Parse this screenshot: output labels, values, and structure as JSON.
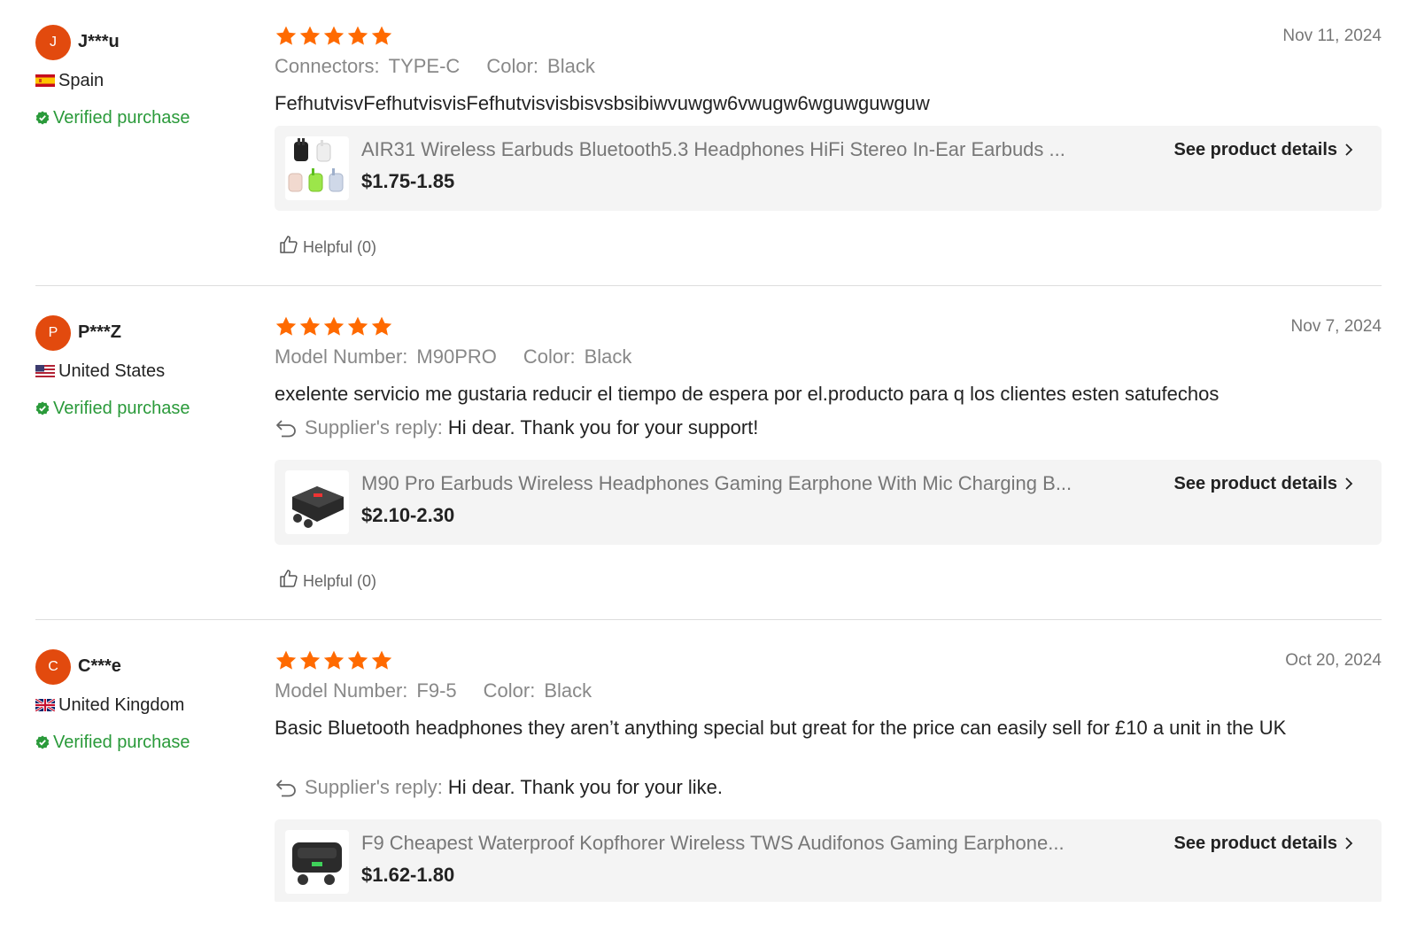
{
  "reviews": [
    {
      "avatar_letter": "J",
      "username": "J***u",
      "country": "Spain",
      "flag": "spain-flag",
      "verified": "Verified purchase",
      "rating": 5,
      "date": "Nov 11, 2024",
      "attributes": [
        {
          "key": "Connectors",
          "value": "TYPE-C"
        },
        {
          "key": "Color",
          "value": "Black"
        }
      ],
      "text": "FefhutvisvFefhutvisvisFefhutvisvisbisvsbsibiwvuwgw6vwugw6wguwguwguw",
      "product": {
        "title": "AIR31 Wireless Earbuds Bluetooth5.3 Headphones HiFi Stereo In-Ear Earbuds ...",
        "price": "$1.75-1.85",
        "details_label": "See product details"
      },
      "helpful": "Helpful (0)"
    },
    {
      "avatar_letter": "P",
      "username": "P***Z",
      "country": "United States",
      "flag": "us-flag",
      "verified": "Verified purchase",
      "rating": 5,
      "date": "Nov 7, 2024",
      "attributes": [
        {
          "key": "Model Number",
          "value": "M90PRO"
        },
        {
          "key": "Color",
          "value": "Black"
        }
      ],
      "text": "exelente servicio me gustaria reducir el tiempo de espera por el.producto para q los clientes esten satufechos",
      "reply_label": "Supplier's reply:",
      "reply_text": "Hi dear. Thank you for your support!",
      "product": {
        "title": "M90 Pro Earbuds Wireless Headphones Gaming Earphone With Mic Charging B...",
        "price": "$2.10-2.30",
        "details_label": "See product details"
      },
      "helpful": "Helpful (0)"
    },
    {
      "avatar_letter": "C",
      "username": "C***e",
      "country": "United Kingdom",
      "flag": "uk-flag",
      "verified": "Verified purchase",
      "rating": 5,
      "date": "Oct 20, 2024",
      "attributes": [
        {
          "key": "Model Number",
          "value": "F9-5"
        },
        {
          "key": "Color",
          "value": "Black"
        }
      ],
      "text": "Basic Bluetooth headphones they aren’t anything special but great for the price can easily sell for £10 a unit in the UK",
      "reply_label": "Supplier's reply:",
      "reply_text": "Hi dear. Thank you for your like.",
      "product": {
        "title": "F9 Cheapest Waterproof Kopfhorer Wireless TWS Audifonos Gaming Earphone...",
        "price": "$1.62-1.80",
        "details_label": "See product details"
      }
    }
  ],
  "colors": {
    "star": "#ff6a00",
    "avatar": "#e24a0e",
    "verified": "#2a9a3a",
    "product_bg": "#f4f4f4"
  }
}
